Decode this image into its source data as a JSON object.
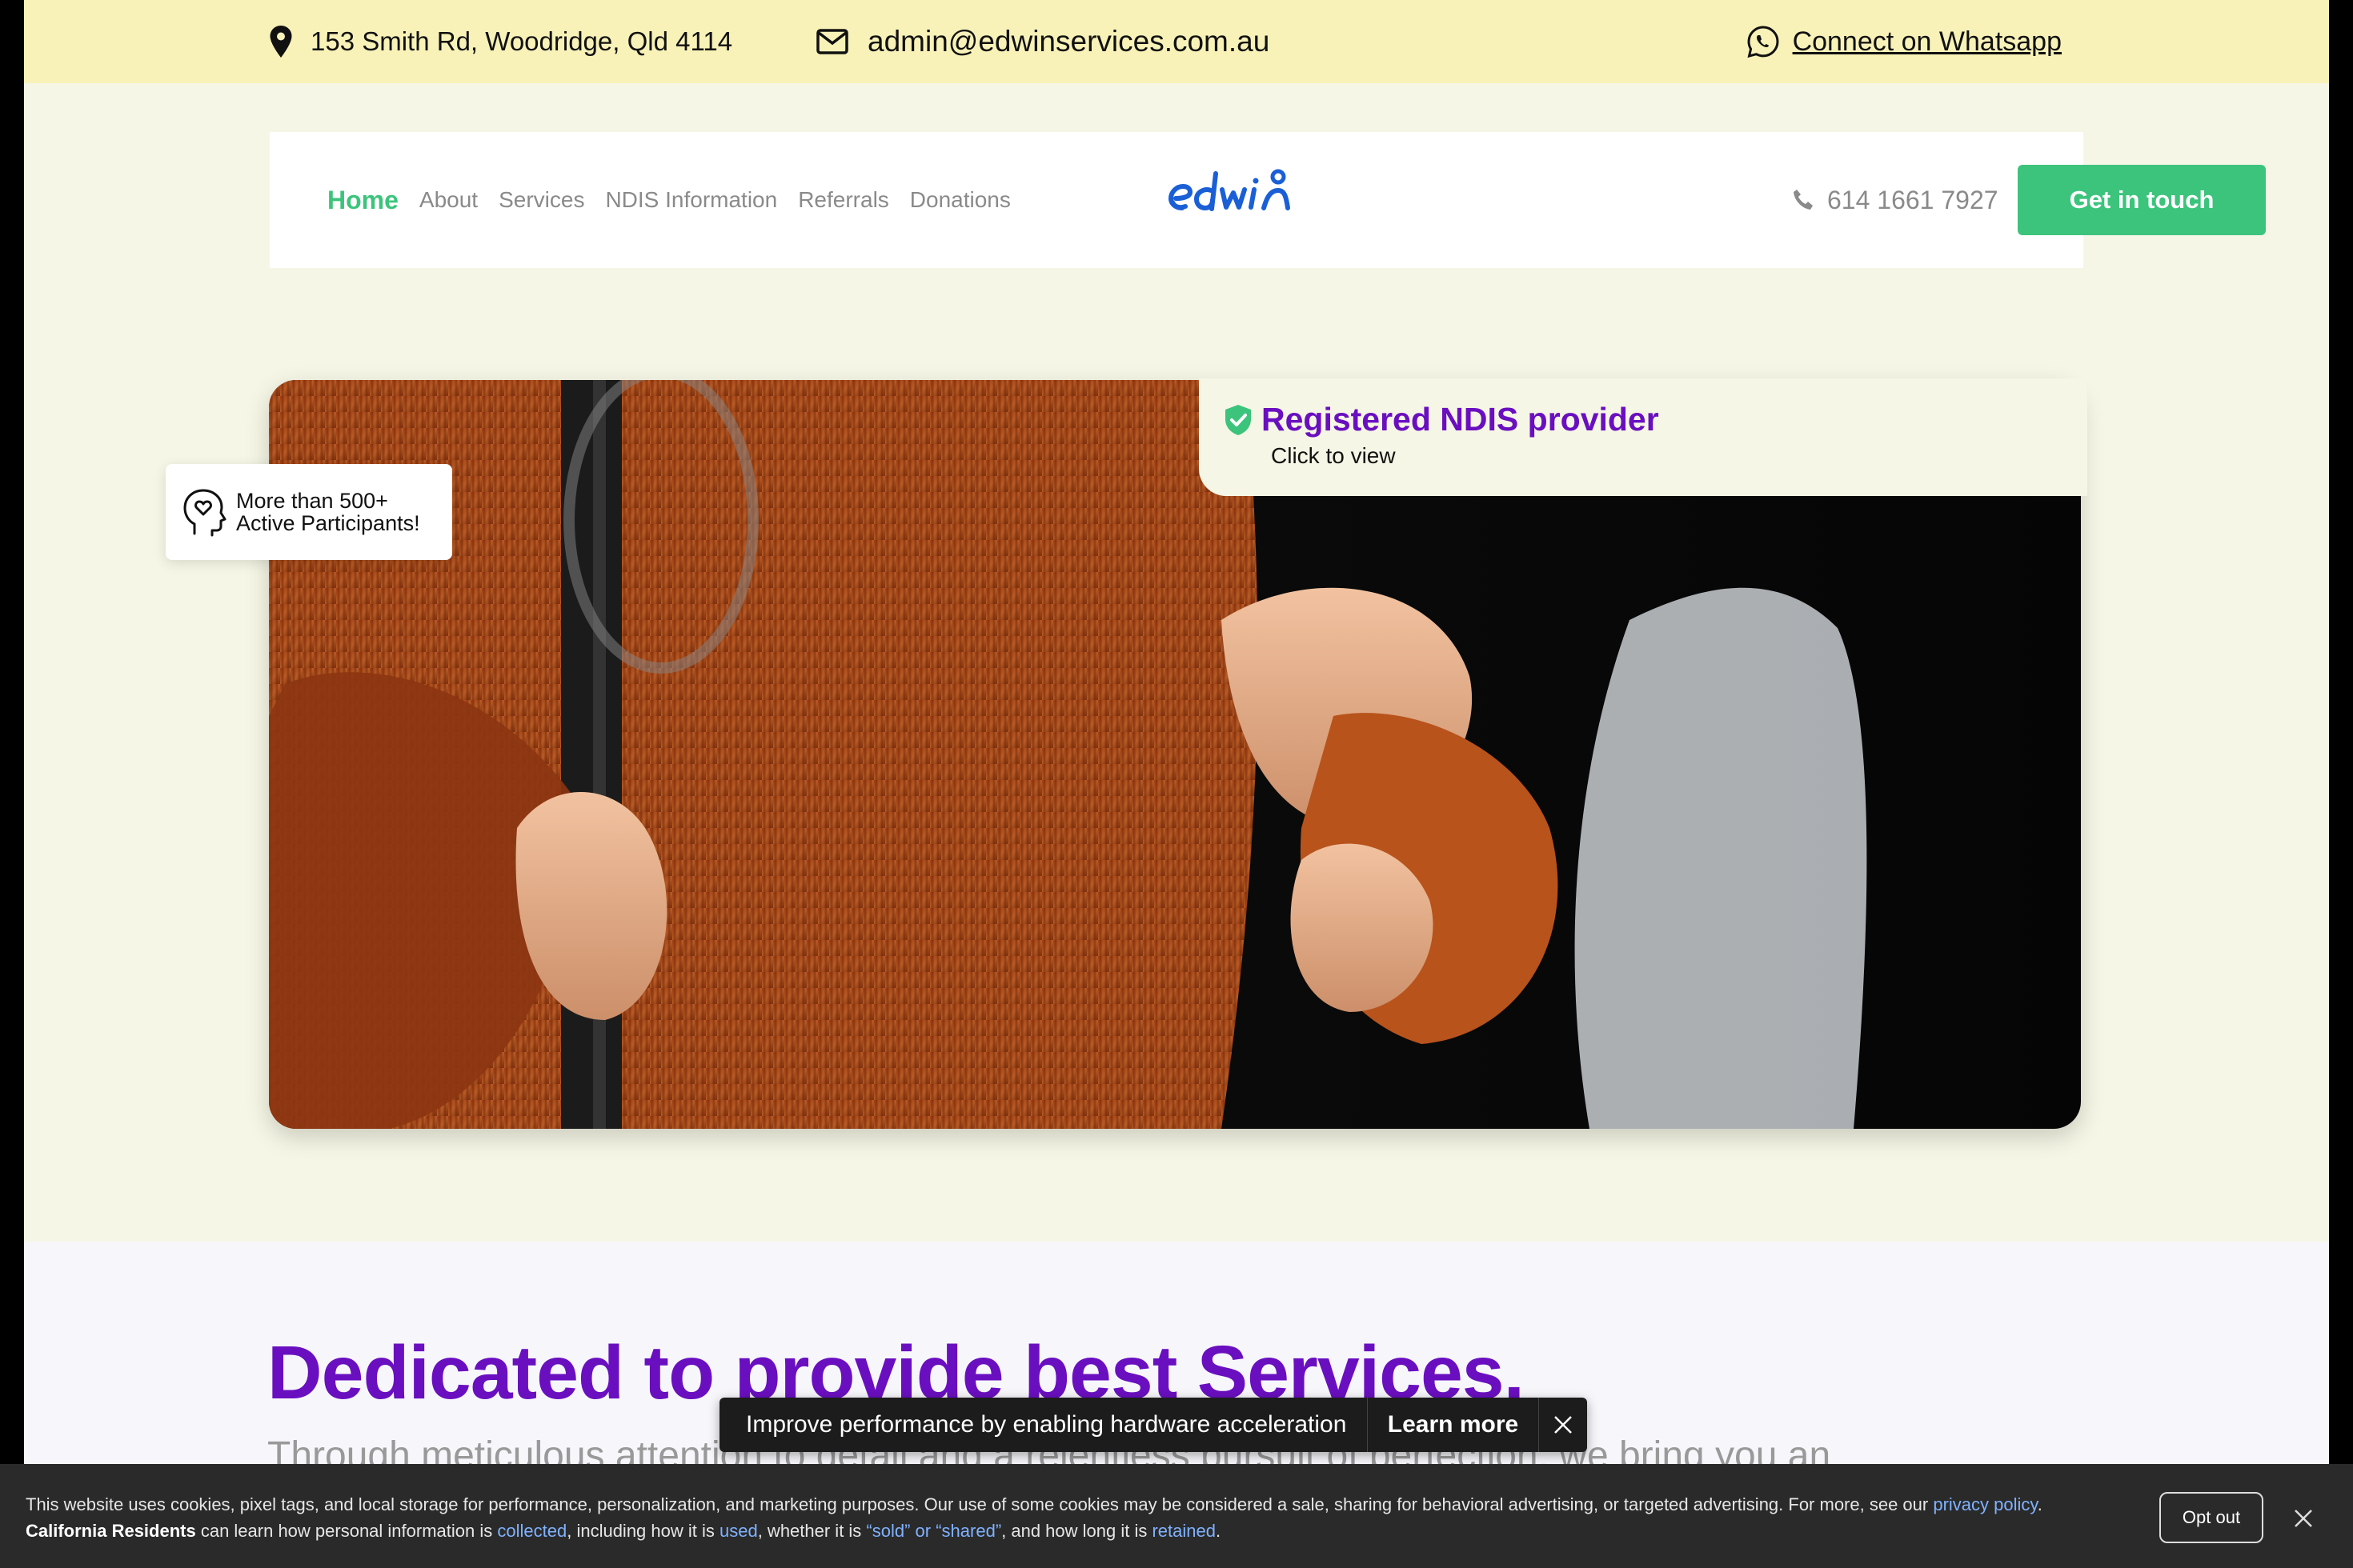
{
  "topbar": {
    "address": "153 Smith Rd, Woodridge, Qld 4114",
    "email": "admin@edwinservices.com.au",
    "whatsapp": "Connect on Whatsapp"
  },
  "nav": {
    "links": [
      "Home",
      "About",
      "Services",
      "NDIS Information",
      "Referrals",
      "Donations"
    ],
    "active": "Home",
    "logo_text": "edwin",
    "phone": "614 1661 7927",
    "cta": "Get in touch",
    "accent": "#3cc47c"
  },
  "hero": {
    "badge_title": "Registered NDIS provider",
    "badge_sub": "Click to view",
    "participants_line1": "More than 500+",
    "participants_line2": "Active Participants!",
    "photo": "hands holding, orange knit sweater"
  },
  "section": {
    "heading": "Dedicated to provide best Services.",
    "subtext": "Through meticulous attention to detail and a relentless pursuit of perfection, we bring you an",
    "heading_color": "#6a0fc0"
  },
  "toast": {
    "message": "Improve performance by enabling hardware acceleration",
    "action": "Learn more"
  },
  "cookie": {
    "part1": "This website uses cookies, pixel tags, and local storage for performance, personalization, and marketing purposes. Our use of some cookies may be considered a sale, sharing for behavioral advertising, or targeted advertising. For more, see our ",
    "privacy_link": "privacy policy",
    "part2": ". ",
    "bold": "California Residents",
    "part3": " can learn how personal information is ",
    "collected": "collected",
    "part4": ", including how it is ",
    "used": "used",
    "part5": ", whether it is ",
    "sold": "“sold” or “shared”",
    "part6": ", and how long it is ",
    "retained": "retained",
    "part7": ".",
    "opt_out": "Opt out"
  }
}
